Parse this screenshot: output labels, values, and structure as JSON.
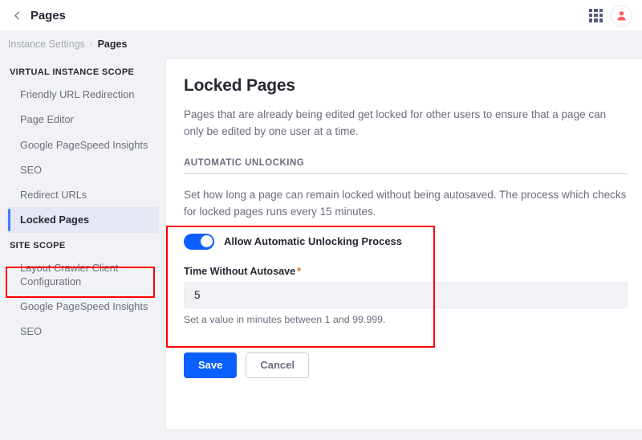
{
  "topbar": {
    "back_icon": "chevron-left-icon",
    "title": "Pages",
    "grid_icon": "app-grid-icon",
    "avatar_icon": "user-avatar-icon",
    "avatar_color": "#ff5f5f"
  },
  "breadcrumb": {
    "parent": "Instance Settings",
    "separator": "›",
    "current": "Pages"
  },
  "sidebar": {
    "groups": [
      {
        "label": "VIRTUAL INSTANCE SCOPE",
        "items": [
          {
            "label": "Friendly URL Redirection",
            "active": false
          },
          {
            "label": "Page Editor",
            "active": false
          },
          {
            "label": "Google PageSpeed Insights",
            "active": false
          },
          {
            "label": "SEO",
            "active": false
          },
          {
            "label": "Redirect URLs",
            "active": false
          },
          {
            "label": "Locked Pages",
            "active": true
          }
        ]
      },
      {
        "label": "SITE SCOPE",
        "items": [
          {
            "label": "Layout Crawler Client Configuration",
            "active": false
          },
          {
            "label": "Google PageSpeed Insights",
            "active": false
          },
          {
            "label": "SEO",
            "active": false
          }
        ]
      }
    ]
  },
  "main": {
    "title": "Locked Pages",
    "description": "Pages that are already being edited get locked for other users to ensure that a page can only be edited by one user at a time.",
    "section": {
      "heading": "AUTOMATIC UNLOCKING",
      "description": "Set how long a page can remain locked without being autosaved. The process which checks for locked pages runs every 15 minutes.",
      "toggle": {
        "label": "Allow Automatic Unlocking Process",
        "state": "on",
        "color": "#0b5fff"
      },
      "field": {
        "label": "Time Without Autosave",
        "required_marker": "*",
        "value": "5",
        "placeholder": "",
        "help": "Set a value in minutes between 1 and 99.999."
      }
    },
    "buttons": {
      "save": "Save",
      "cancel": "Cancel"
    }
  },
  "annotations": {
    "sidebar_highlight": "red-rectangle-around-locked-pages-nav-item",
    "form_highlight": "red-rectangle-around-automatic-unlocking-form"
  }
}
